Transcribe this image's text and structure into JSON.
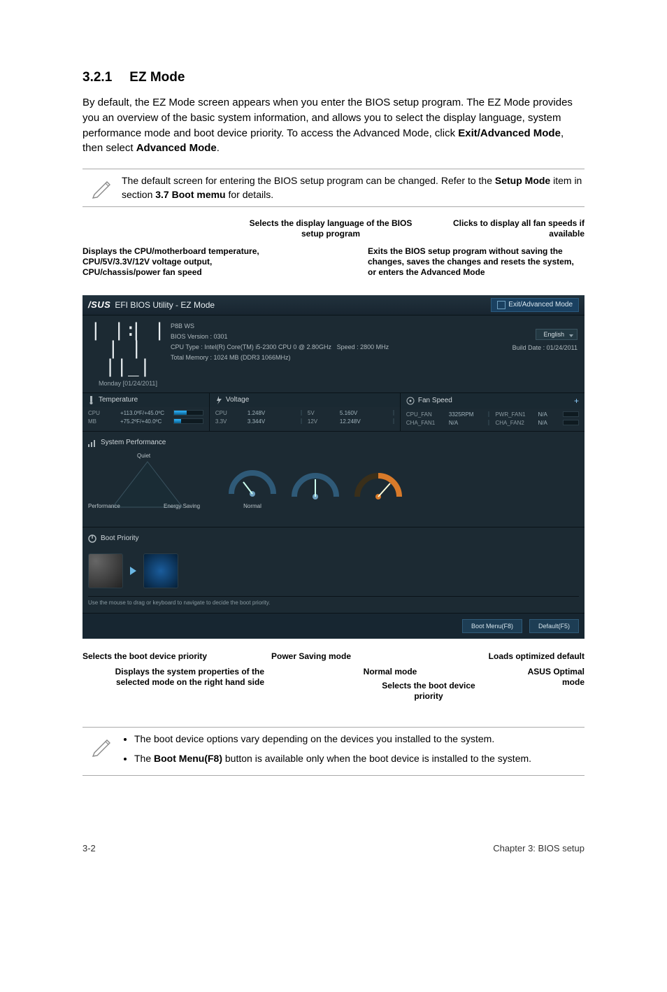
{
  "doc": {
    "section_num": "3.2.1",
    "section_title": "EZ Mode",
    "intro": "By default, the EZ Mode screen appears when you enter the BIOS setup program. The EZ Mode provides you an overview of the basic system information, and allows you to select the display language, system performance mode and boot device priority. To access the Advanced Mode, click Exit/Advanced Mode, then select Advanced Mode.",
    "intro_bold1": "Exit/Advanced Mode",
    "intro_bold2": "Advanced Mode",
    "note1_a": "The default screen for entering the BIOS setup program can be changed. Refer to the ",
    "note1_b": "Setup Mode",
    "note1_c": " item in section ",
    "note1_d": "3.7 Boot memu",
    "note1_e": " for details.",
    "note2_li1": "The boot device options vary depending on the devices you installed to the system.",
    "note2_li2a": "The ",
    "note2_li2b": "Boot Menu(F8)",
    "note2_li2c": " button is available only when the boot device is installed to the system."
  },
  "callout": {
    "c1": "Displays the CPU/motherboard temperature, CPU/5V/3.3V/12V voltage output, CPU/chassis/power fan speed",
    "c2": "Selects the display language of the BIOS setup program",
    "c3": "Clicks to display all fan speeds if available",
    "c4": "Exits the BIOS setup program without saving the changes, saves the changes and resets the system, or enters the Advanced Mode",
    "cb1": "Selects the boot device  priority",
    "cb2": "Power Saving mode",
    "cb3": "Loads optimized default",
    "cb4": "Displays the system properties of the selected mode on the right hand side",
    "cb5": "Normal mode",
    "cb6": "ASUS Optimal mode",
    "cb7": "Selects the boot device priority"
  },
  "bios": {
    "logo": "/SUS",
    "title": "EFI BIOS Utility - EZ Mode",
    "exit_adv": "Exit/Advanced Mode",
    "board": "P8B WS",
    "ver": "BIOS Version : 0301",
    "build": "Build Date : 01/24/2011",
    "cpu_type": "CPU Type : Intel(R) Core(TM) i5-2300 CPU 0 @ 2.80GHz",
    "speed": "Speed : 2800 MHz",
    "mem": "Total Memory : 1024 MB (DDR3 1066MHz)",
    "clock": "11:10",
    "day": "Monday [01/24/2011]",
    "lang": "English",
    "panels": {
      "temp": "Temperature",
      "volt": "Voltage",
      "fan": "Fan Speed"
    },
    "temp": {
      "cpu_lbl": "CPU",
      "cpu_val": "+113.0ºF/+45.0ºC",
      "mb_lbl": "MB",
      "mb_val": "+75.2ºF/+40.0ºC"
    },
    "volt": {
      "cpu_lbl": "CPU",
      "cpu_val": "1.248V",
      "v5_lbl": "5V",
      "v5_val": "5.160V",
      "v33_lbl": "3.3V",
      "v33_val": "3.344V",
      "v12_lbl": "12V",
      "v12_val": "12.248V"
    },
    "fan": {
      "cpu_lbl": "CPU_FAN",
      "cpu_val": "3325RPM",
      "pwr_lbl": "PWR_FAN1",
      "pwr_val": "N/A",
      "cha1_lbl": "CHA_FAN1",
      "cha1_val": "N/A",
      "cha2_lbl": "CHA_FAN2",
      "cha2_val": "N/A"
    },
    "perf": {
      "title": "System Performance",
      "quiet": "Quiet",
      "performance": "Performance",
      "energy": "Energy Saving",
      "normal": "Normal"
    },
    "boot": {
      "title": "Boot Priority",
      "hint": "Use the mouse to drag or keyboard to navigate to decide the boot priority."
    },
    "btn_boot": "Boot Menu(F8)",
    "btn_default": "Default(F5)"
  },
  "footer": {
    "left": "3-2",
    "right": "Chapter 3: BIOS setup"
  }
}
